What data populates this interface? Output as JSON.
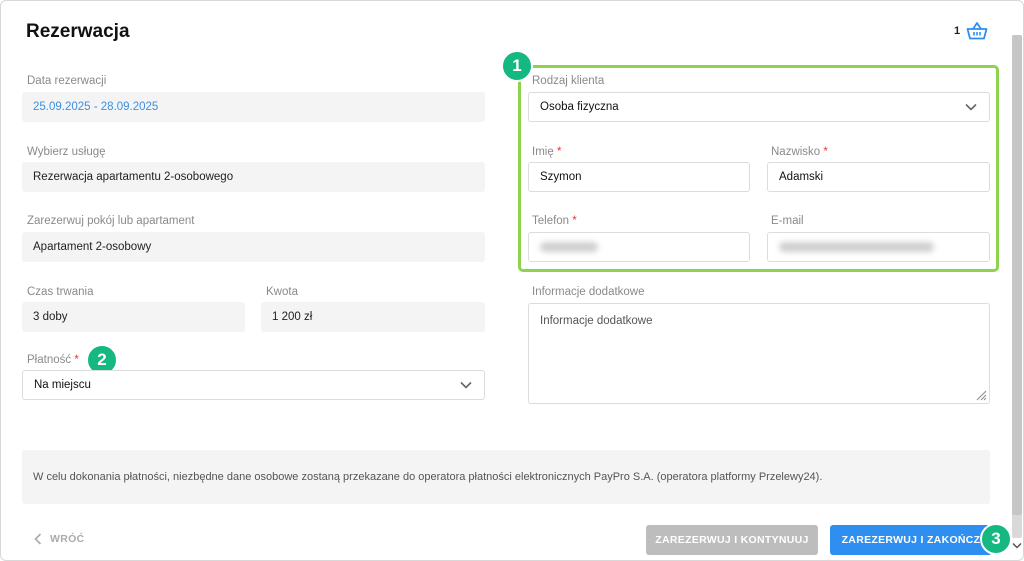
{
  "modal": {
    "title": "Rezerwacja",
    "cart_count": "1"
  },
  "left": {
    "date_label": "Data rezerwacji",
    "date_value": "25.09.2025 - 28.09.2025",
    "service_label": "Wybierz usługę",
    "service_value": "Rezerwacja apartamentu 2-osobowego",
    "room_label": "Zarezerwuj pokój lub apartament",
    "room_value": "Apartament 2-osobowy",
    "duration_label": "Czas trwania",
    "duration_value": "3 doby",
    "amount_label": "Kwota",
    "amount_value": "1 200 zł",
    "payment_label": "Płatność",
    "payment_value": "Na miejscu"
  },
  "right": {
    "client_type_label": "Rodzaj klienta",
    "client_type_value": "Osoba fizyczna",
    "first_name_label": "Imię",
    "first_name_value": "Szymon",
    "last_name_label": "Nazwisko",
    "last_name_value": "Adamski",
    "phone_label": "Telefon",
    "email_label": "E-mail",
    "additional_label": "Informacje dodatkowe",
    "additional_placeholder": "Informacje dodatkowe"
  },
  "required_mark": "*",
  "badges": {
    "one": "1",
    "two": "2",
    "three": "3"
  },
  "info_text": "W celu dokonania płatności, niezbędne dane osobowe zostaną przekazane do operatora płatności elektronicznych PayPro S.A. (operatora platformy Przelewy24).",
  "footer": {
    "back_label": "WRÓĆ",
    "reserve_continue_label": "ZAREZERWUJ I KONTYNUUJ",
    "reserve_finish_label": "ZAREZERWUJ I ZAKOŃCZ"
  },
  "colors": {
    "highlight_border": "#8ed34e",
    "badge": "#16b881",
    "primary_button": "#2f8ff0",
    "disabled_button": "#bdbdbd",
    "date_text": "#3d8fe0"
  },
  "icons": {
    "cart": "shopping-basket-icon",
    "chevron": "chevron-down-icon",
    "back": "chevron-left-icon"
  }
}
